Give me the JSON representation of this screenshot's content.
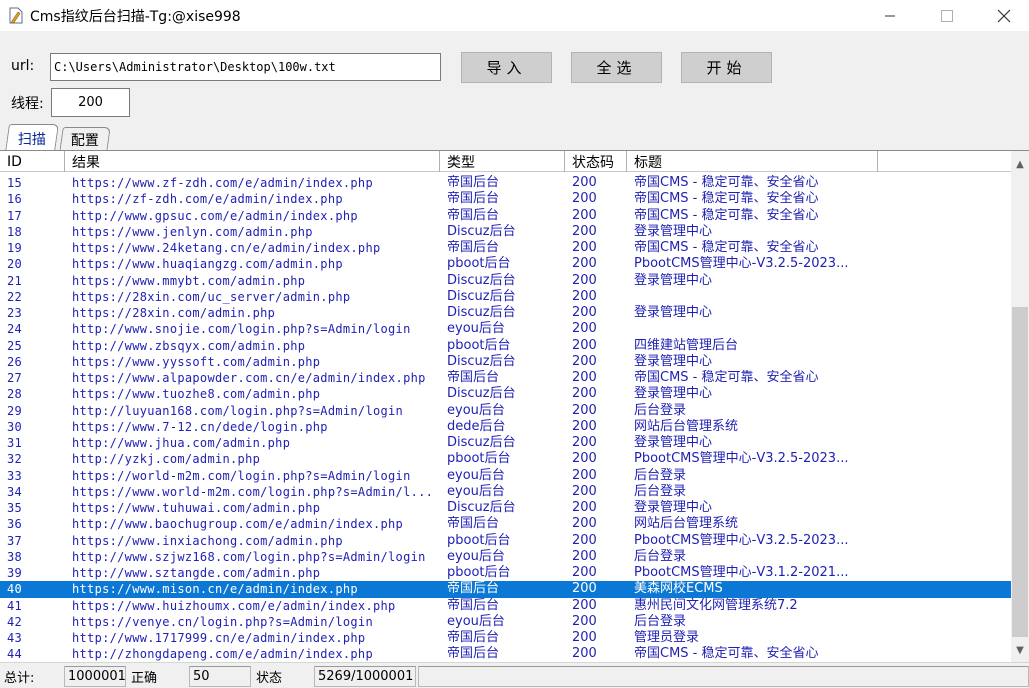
{
  "window": {
    "title": "Cms指纹后台扫描-Tg:@xise998"
  },
  "controls": {
    "url_label": "url:",
    "url_value": "C:\\Users\\Administrator\\Desktop\\100w.txt",
    "import_label": "导入",
    "select_all_label": "全选",
    "start_label": "开始",
    "threads_label": "线程:",
    "threads_value": "200"
  },
  "tabs": [
    {
      "label": "扫描",
      "active": true
    },
    {
      "label": "配置",
      "active": false
    }
  ],
  "grid": {
    "columns": [
      "ID",
      "结果",
      "类型",
      "状态码",
      "标题"
    ],
    "selected_id": "40",
    "rows": [
      {
        "id": "15",
        "url": "https://www.zf-zdh.com/e/admin/index.php",
        "type": "帝国后台",
        "code": "200",
        "title": "帝国CMS - 稳定可靠、安全省心"
      },
      {
        "id": "16",
        "url": "https://zf-zdh.com/e/admin/index.php",
        "type": "帝国后台",
        "code": "200",
        "title": "帝国CMS - 稳定可靠、安全省心"
      },
      {
        "id": "17",
        "url": "http://www.gpsuc.com/e/admin/index.php",
        "type": "帝国后台",
        "code": "200",
        "title": "帝国CMS - 稳定可靠、安全省心"
      },
      {
        "id": "18",
        "url": "https://www.jenlyn.com/admin.php",
        "type": "Discuz后台",
        "code": "200",
        "title": "登录管理中心"
      },
      {
        "id": "19",
        "url": "https://www.24ketang.cn/e/admin/index.php",
        "type": "帝国后台",
        "code": "200",
        "title": "帝国CMS - 稳定可靠、安全省心"
      },
      {
        "id": "20",
        "url": "https://www.huaqiangzg.com/admin.php",
        "type": "pboot后台",
        "code": "200",
        "title": "PbootCMS管理中心-V3.2.5-2023..."
      },
      {
        "id": "21",
        "url": "https://www.mmybt.com/admin.php",
        "type": "Discuz后台",
        "code": "200",
        "title": "登录管理中心"
      },
      {
        "id": "22",
        "url": "https://28xin.com/uc_server/admin.php",
        "type": "Discuz后台",
        "code": "200",
        "title": ""
      },
      {
        "id": "23",
        "url": "https://28xin.com/admin.php",
        "type": "Discuz后台",
        "code": "200",
        "title": "登录管理中心"
      },
      {
        "id": "24",
        "url": "http://www.snojie.com/login.php?s=Admin/login",
        "type": "eyou后台",
        "code": "200",
        "title": ""
      },
      {
        "id": "25",
        "url": "http://www.zbsqyx.com/admin.php",
        "type": "pboot后台",
        "code": "200",
        "title": "四维建站管理后台"
      },
      {
        "id": "26",
        "url": "https://www.yyssoft.com/admin.php",
        "type": "Discuz后台",
        "code": "200",
        "title": "登录管理中心"
      },
      {
        "id": "27",
        "url": "https://www.alpapowder.com.cn/e/admin/index.php",
        "type": "帝国后台",
        "code": "200",
        "title": "帝国CMS - 稳定可靠、安全省心"
      },
      {
        "id": "28",
        "url": "https://www.tuozhe8.com/admin.php",
        "type": "Discuz后台",
        "code": "200",
        "title": "登录管理中心"
      },
      {
        "id": "29",
        "url": "http://luyuan168.com/login.php?s=Admin/login",
        "type": "eyou后台",
        "code": "200",
        "title": "后台登录"
      },
      {
        "id": "30",
        "url": "https://www.7-12.cn/dede/login.php",
        "type": "dede后台",
        "code": "200",
        "title": "网站后台管理系统"
      },
      {
        "id": "31",
        "url": "http://www.jhua.com/admin.php",
        "type": "Discuz后台",
        "code": "200",
        "title": "登录管理中心"
      },
      {
        "id": "32",
        "url": "http://yzkj.com/admin.php",
        "type": "pboot后台",
        "code": "200",
        "title": "PbootCMS管理中心-V3.2.5-2023..."
      },
      {
        "id": "33",
        "url": "https://world-m2m.com/login.php?s=Admin/login",
        "type": "eyou后台",
        "code": "200",
        "title": "后台登录"
      },
      {
        "id": "34",
        "url": "https://www.world-m2m.com/login.php?s=Admin/l...",
        "type": "eyou后台",
        "code": "200",
        "title": "后台登录"
      },
      {
        "id": "35",
        "url": "https://www.tuhuwai.com/admin.php",
        "type": "Discuz后台",
        "code": "200",
        "title": "登录管理中心"
      },
      {
        "id": "36",
        "url": "http://www.baochugroup.com/e/admin/index.php",
        "type": "帝国后台",
        "code": "200",
        "title": "网站后台管理系统"
      },
      {
        "id": "37",
        "url": "https://www.inxiachong.com/admin.php",
        "type": "pboot后台",
        "code": "200",
        "title": "PbootCMS管理中心-V3.2.5-2023..."
      },
      {
        "id": "38",
        "url": "http://www.szjwz168.com/login.php?s=Admin/login",
        "type": "eyou后台",
        "code": "200",
        "title": "后台登录"
      },
      {
        "id": "39",
        "url": "http://www.sztangde.com/admin.php",
        "type": "pboot后台",
        "code": "200",
        "title": "PbootCMS管理中心-V3.1.2-2021..."
      },
      {
        "id": "40",
        "url": "https://www.mison.cn/e/admin/index.php",
        "type": "帝国后台",
        "code": "200",
        "title": "美森网校ECMS"
      },
      {
        "id": "41",
        "url": "https://www.huizhoumx.com/e/admin/index.php",
        "type": "帝国后台",
        "code": "200",
        "title": "惠州民间文化网管理系统7.2"
      },
      {
        "id": "42",
        "url": "https://venye.cn/login.php?s=Admin/login",
        "type": "eyou后台",
        "code": "200",
        "title": "后台登录"
      },
      {
        "id": "43",
        "url": "http://www.1717999.cn/e/admin/index.php",
        "type": "帝国后台",
        "code": "200",
        "title": "管理员登录"
      },
      {
        "id": "44",
        "url": "http://zhongdapeng.com/e/admin/index.php",
        "type": "帝国后台",
        "code": "200",
        "title": "帝国CMS - 稳定可靠、安全省心"
      }
    ]
  },
  "statusbar": {
    "total_label": "总计:",
    "total_value": "1000001",
    "correct_label": "正确",
    "correct_value": "50",
    "state_label": "状态",
    "progress_text": "5269/1000001"
  }
}
